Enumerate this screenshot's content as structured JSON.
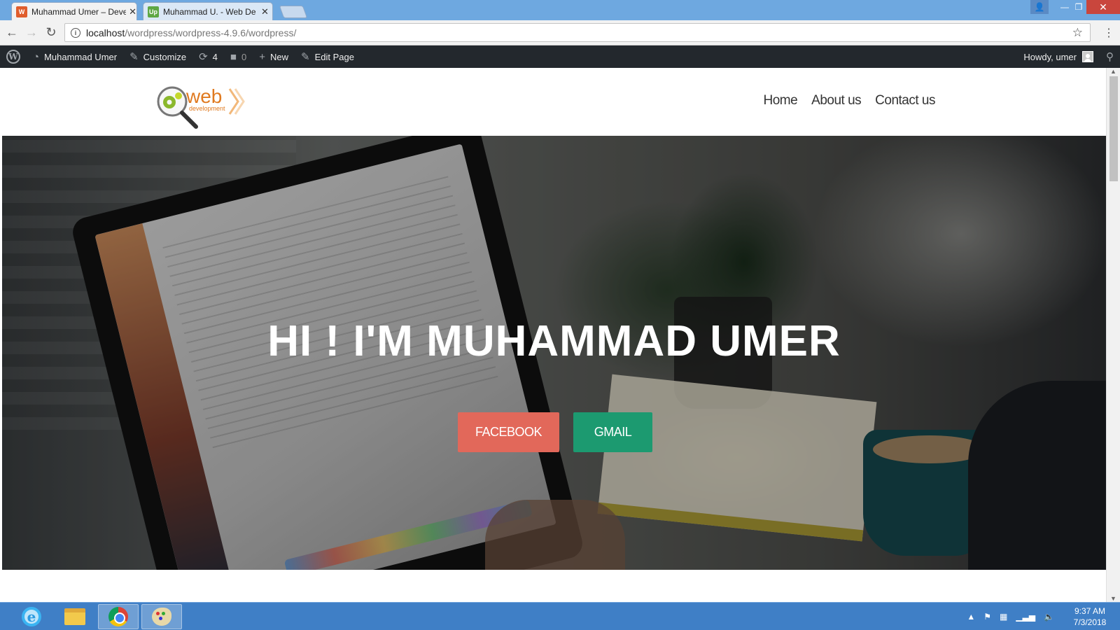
{
  "browser": {
    "tabs": [
      {
        "title": "Muhammad Umer – Deve",
        "active": true,
        "favicon": "wordpress-favicon-icon",
        "favicon_color": "#e05d2c"
      },
      {
        "title": "Muhammad U. - Web De",
        "active": false,
        "favicon": "upwork-favicon-icon",
        "favicon_color": "#5fa744",
        "favicon_text": "Up"
      }
    ],
    "address": {
      "host": "localhost",
      "path": "/wordpress/wordpress-4.9.6/wordpress/"
    }
  },
  "adminbar": {
    "site_name": "Muhammad Umer",
    "customize": "Customize",
    "updates_count": "4",
    "comments_count": "0",
    "new": "New",
    "edit_page": "Edit Page",
    "howdy": "Howdy, umer"
  },
  "site": {
    "logo_text": "web",
    "logo_subtext": "development",
    "nav": [
      "Home",
      "About us",
      "Contact us"
    ]
  },
  "hero": {
    "title": "HI ! I'M MUHAMMAD UMER",
    "buttons": [
      {
        "label": "FACEBOOK",
        "color": "#e2685a"
      },
      {
        "label": "GMAIL",
        "color": "#1c9a70"
      }
    ]
  },
  "taskbar": {
    "time": "9:37 AM",
    "date": "7/3/2018"
  },
  "colors": {
    "adminbar_bg": "#23282d",
    "titlebar_bg": "#6ea8e0",
    "taskbar_bg": "#3f7fc6"
  }
}
